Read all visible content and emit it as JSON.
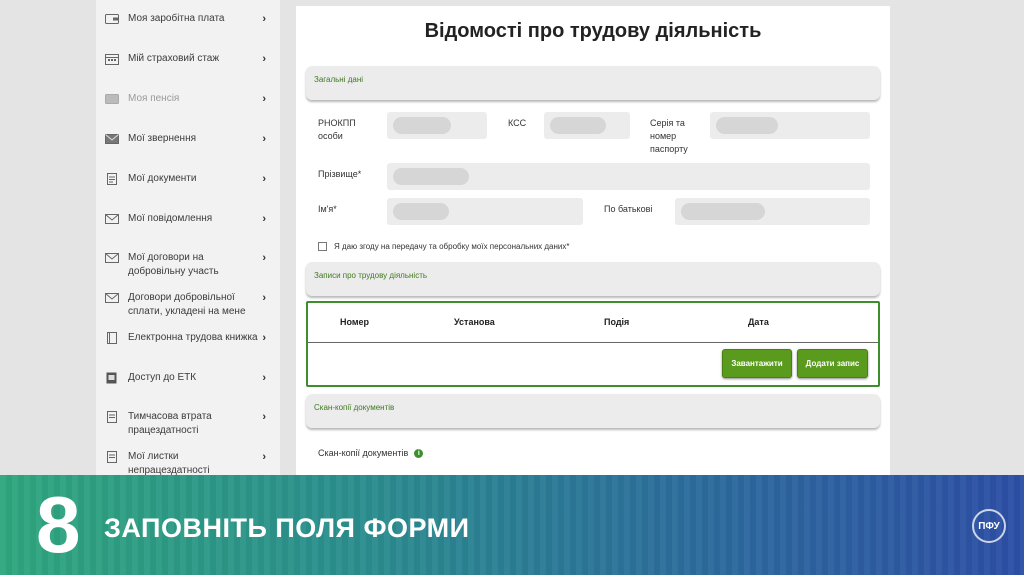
{
  "sidebar": {
    "items": [
      {
        "label": "Моя заробітна плата",
        "icon": "wallet-icon"
      },
      {
        "label": "Мій страховий стаж",
        "icon": "calendar-icon"
      },
      {
        "label": "Моя пенсія",
        "icon": "wallet-icon"
      },
      {
        "label": "Мої звернення",
        "icon": "envelope-icon"
      },
      {
        "label": "Мої документи",
        "icon": "document-icon"
      },
      {
        "label": "Мої повідомлення",
        "icon": "envelope-icon"
      },
      {
        "label": "Мої договори на добровільну участь",
        "icon": "envelope-icon"
      },
      {
        "label": "Договори добровільної сплати, укладені на мене",
        "icon": "envelope-icon"
      },
      {
        "label": "Електронна трудова книжка",
        "icon": "book-icon"
      },
      {
        "label": "Доступ до ЕТК",
        "icon": "book-access-icon"
      },
      {
        "label": "Тимчасова втрата працездатності",
        "icon": "document-icon"
      },
      {
        "label": "Мої листки непрацездатності",
        "icon": "document-icon"
      }
    ],
    "chevron": "›"
  },
  "main": {
    "title": "Відомості про трудову діяльність",
    "section_general": "Загальні дані",
    "fields": {
      "rnokpp_label": "РНОКПП особи",
      "kss_label": "КСС",
      "passport_label": "Серія та номер паспорту",
      "surname_label": "Прізвище*",
      "name_label": "Ім'я*",
      "patronymic_label": "По батькові"
    },
    "consent_label": "Я даю згоду на передачу та обробку моїх персональних даних*",
    "section_records": "Записи про трудову діяльність",
    "table": {
      "columns": [
        "Номер",
        "Установа",
        "Подія",
        "Дата"
      ]
    },
    "buttons": {
      "upload": "Завантажити",
      "add_record": "Додати запис"
    },
    "section_scans": "Скан-копії документів",
    "scans_label": "Скан-копії документів"
  },
  "banner": {
    "step_number": "8",
    "step_text": "ЗАПОВНІТЬ ПОЛЯ ФОРМИ",
    "logo_text": "ПФУ"
  },
  "colors": {
    "accent_green": "#5a9a1c",
    "border_green": "#3e8e2e",
    "banner_start": "#2fa77e",
    "banner_end": "#2d4fa6"
  }
}
